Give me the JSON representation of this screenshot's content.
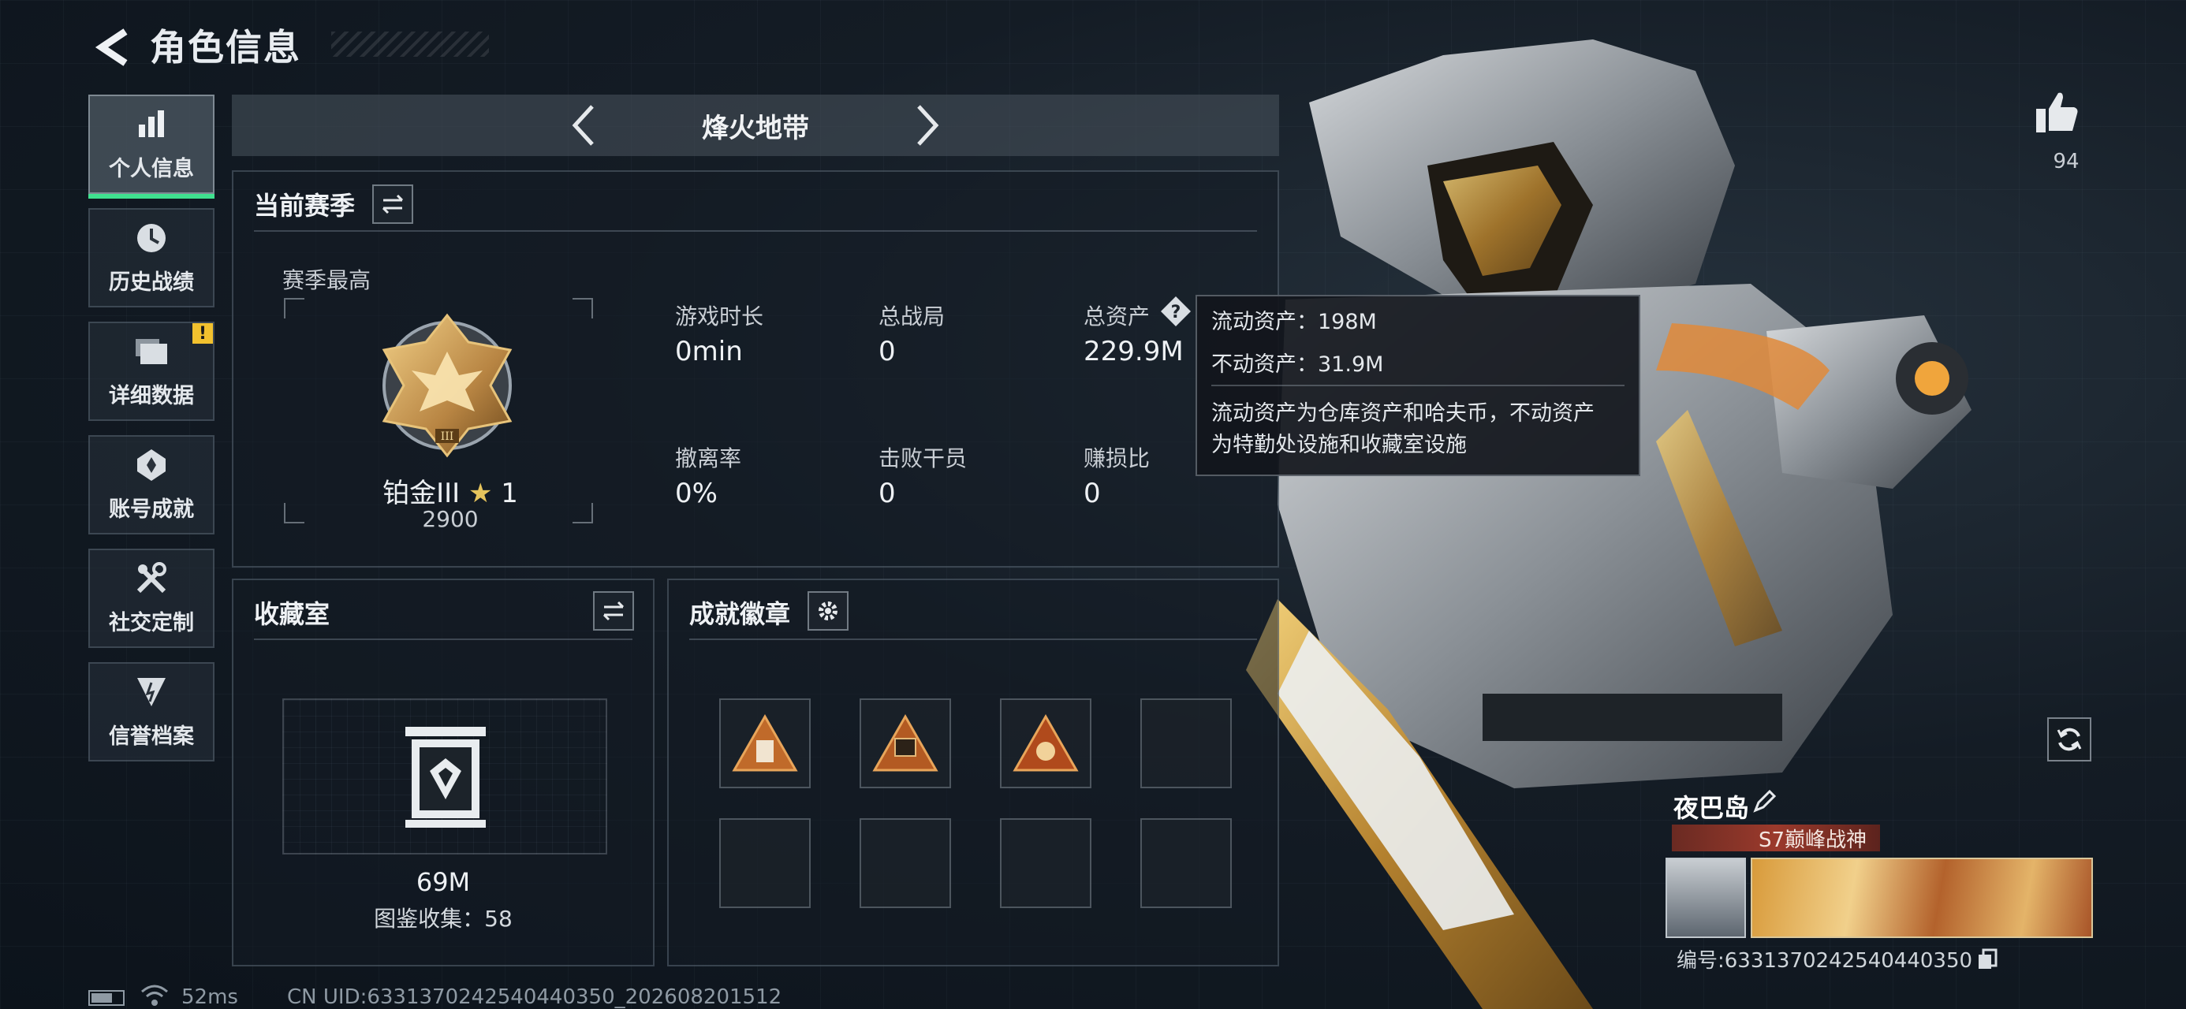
{
  "header": {
    "title": "角色信息"
  },
  "nav": {
    "items": [
      {
        "label": "个人信息",
        "icon": "bar-chart-icon",
        "active": true
      },
      {
        "label": "历史战绩",
        "icon": "clock-icon"
      },
      {
        "label": "详细数据",
        "icon": "folder-icon",
        "badge": "!"
      },
      {
        "label": "账号成就",
        "icon": "medal-icon"
      },
      {
        "label": "社交定制",
        "icon": "wrench-icon"
      },
      {
        "label": "信誉档案",
        "icon": "emblem-icon"
      }
    ]
  },
  "mode": {
    "title": "烽火地带"
  },
  "season": {
    "title": "当前赛季",
    "highest_label": "赛季最高",
    "rank": "铂金III",
    "stars": "1",
    "score": "2900",
    "stats": [
      {
        "label": "游戏时长",
        "value": "0min"
      },
      {
        "label": "总战局",
        "value": "0"
      },
      {
        "label": "总资产",
        "value": "229.9M"
      },
      {
        "label": "撤离率",
        "value": "0%"
      },
      {
        "label": "击败干员",
        "value": "0"
      },
      {
        "label": "赚损比",
        "value": "0"
      }
    ]
  },
  "tooltip": {
    "liquid": "流动资产：198M",
    "fixed": "不动资产：31.9M",
    "desc1": "流动资产为仓库资产和哈夫币，不动资产",
    "desc2": "为特勤处设施和收藏室设施"
  },
  "collection": {
    "title": "收藏室",
    "value": "69M",
    "collected": "图鉴收集：58"
  },
  "achievements": {
    "title": "成就徽章"
  },
  "profile": {
    "likes": "94",
    "name": "夜巴岛",
    "title_card": "S7巅峰战神",
    "uid_line": "编号:6331370242540440350"
  },
  "status_bar": {
    "ping": "52ms",
    "uid": "CN UID:6331370242540440350_202608201512"
  },
  "colors": {
    "accent": "#3fe08f",
    "warning": "#f2c12e",
    "rank_gold": "#b98a4e"
  }
}
